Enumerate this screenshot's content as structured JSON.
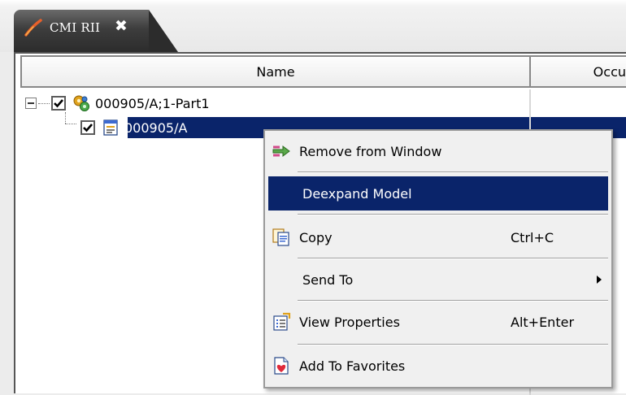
{
  "tab": {
    "title": "CMI RII",
    "close_glyph": "✖",
    "icon": "pen-stroke-icon"
  },
  "table": {
    "columns": [
      {
        "label": "Name"
      },
      {
        "label": "Occu"
      }
    ]
  },
  "tree": {
    "root": {
      "label": "000905/A;1-Part1",
      "checked": true,
      "icon": "assembly-gears-icon"
    },
    "child": {
      "label": "000905/A",
      "checked": true,
      "icon": "model-document-icon",
      "selected": true
    }
  },
  "context_menu": {
    "items": [
      {
        "label": "Remove from Window",
        "icon": "remove-arrow-icon"
      },
      {
        "label": "Deexpand Model",
        "highlighted": true
      },
      {
        "label": "Copy",
        "shortcut": "Ctrl+C",
        "icon": "copy-icon"
      },
      {
        "label": "Send To",
        "has_submenu": true
      },
      {
        "label": "View Properties",
        "shortcut": "Alt+Enter",
        "icon": "properties-icon"
      },
      {
        "label": "Add To Favorites",
        "icon": "favorites-icon"
      }
    ]
  },
  "colors": {
    "selection": "#0a246a",
    "menu_background": "#f0f0f0",
    "tab_background": "#3d3d3d"
  }
}
